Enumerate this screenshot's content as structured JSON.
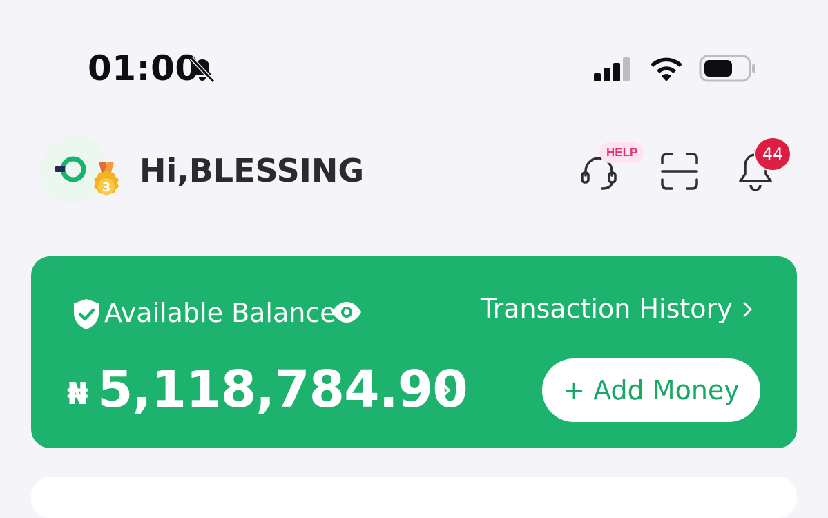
{
  "status_bar": {
    "time": "01:00",
    "icons": [
      "bell-slash-icon",
      "signal-icon",
      "wifi-icon",
      "battery-icon"
    ]
  },
  "header": {
    "greeting": "Hi,BLESSING",
    "medal_level": "3",
    "help_badge": "HELP",
    "notification_count": "44"
  },
  "balance_card": {
    "label": "Available Balance",
    "transaction_history": "Transaction History",
    "currency_symbol": "₦",
    "amount": "5,118,784.90",
    "add_money": "+ Add Money",
    "colors": {
      "card": "#1db36e",
      "button_text": "#1aa866"
    }
  },
  "colors": {
    "background": "#f5f4f9",
    "badge_red": "#dc1e43",
    "help_pink": "#e0357a"
  }
}
